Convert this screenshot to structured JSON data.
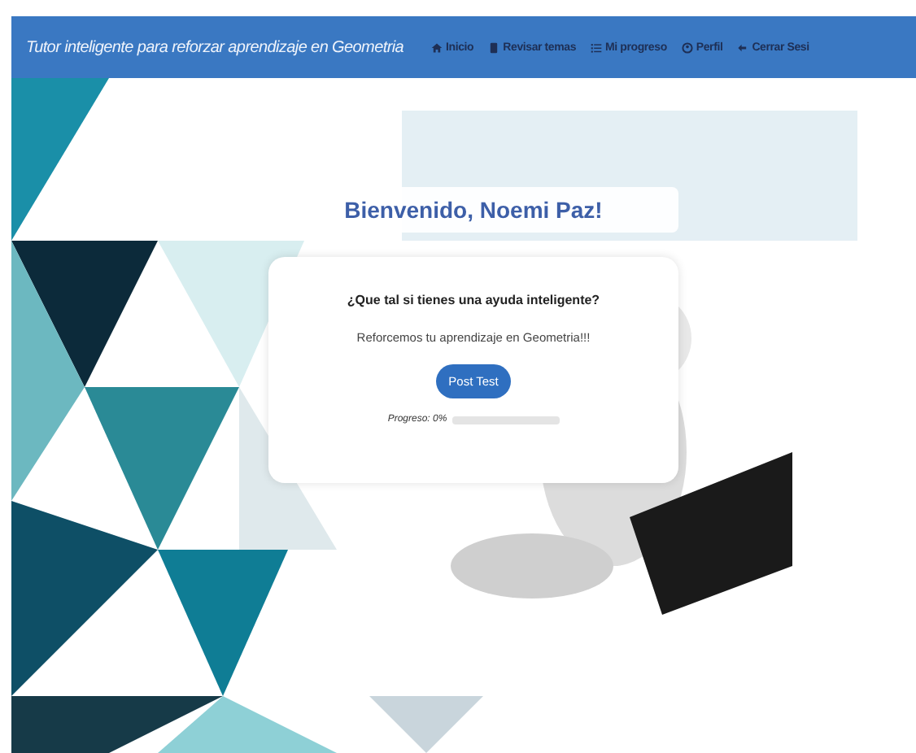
{
  "navbar": {
    "title": "Tutor inteligente para reforzar aprendizaje en Geometria",
    "items": [
      {
        "label": "Inicio"
      },
      {
        "label": "Revisar temas"
      },
      {
        "label": "Mi progreso"
      },
      {
        "label": "Perfil"
      },
      {
        "label": "Cerrar Sesi"
      }
    ]
  },
  "welcome": "Bienvenido, Noemi Paz!",
  "card": {
    "heading": "¿Que tal si tienes una ayuda inteligente?",
    "text": "Reforcemos tu aprendizaje en Geometria!!!",
    "button": "Post Test",
    "progress_label": "Progreso: 0%",
    "level": 0
  }
}
